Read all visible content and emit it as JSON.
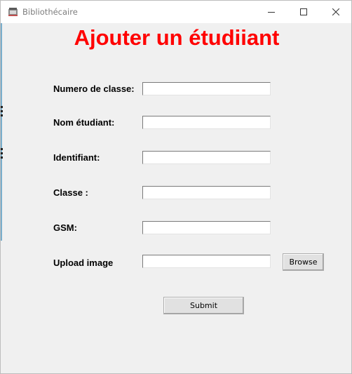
{
  "window": {
    "title": "Bibliothécaire",
    "controls": {
      "minimize": "minimize-icon",
      "maximize": "maximize-icon",
      "close": "close-icon"
    }
  },
  "form": {
    "heading": "Ajouter un étudiiant",
    "fields": [
      {
        "label": "Numero de classe:",
        "value": ""
      },
      {
        "label": "Nom étudiant:",
        "value": ""
      },
      {
        "label": "Identifiant:",
        "value": ""
      },
      {
        "label": "Classe :",
        "value": ""
      },
      {
        "label": "GSM:",
        "value": ""
      },
      {
        "label": "Upload image",
        "value": ""
      }
    ],
    "browse_label": "Browse",
    "submit_label": "Submit"
  },
  "colors": {
    "heading": "#ff0000",
    "background": "#f0f0f0"
  }
}
